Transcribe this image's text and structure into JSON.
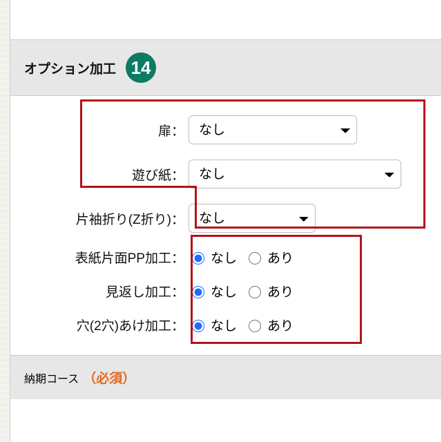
{
  "sections": {
    "options": {
      "title": "オプション加工",
      "badge_number": "14",
      "fields": {
        "tobira": {
          "label": "扉",
          "value": "なし"
        },
        "asobigami": {
          "label": "遊び紙",
          "value": "なし"
        },
        "katasodeori": {
          "label": "片袖折り(Z折り)",
          "value": "なし"
        },
        "pp": {
          "label": "表紙片面PP加工",
          "nashi": "なし",
          "ari": "あり"
        },
        "mikae": {
          "label": "見返し加工",
          "nashi": "なし",
          "ari": "あり"
        },
        "ana": {
          "label": "穴(2穴)あけ加工",
          "nashi": "なし",
          "ari": "あり"
        }
      }
    },
    "nouki": {
      "title": "納期コース",
      "required": "（必須）"
    }
  },
  "colon": "："
}
